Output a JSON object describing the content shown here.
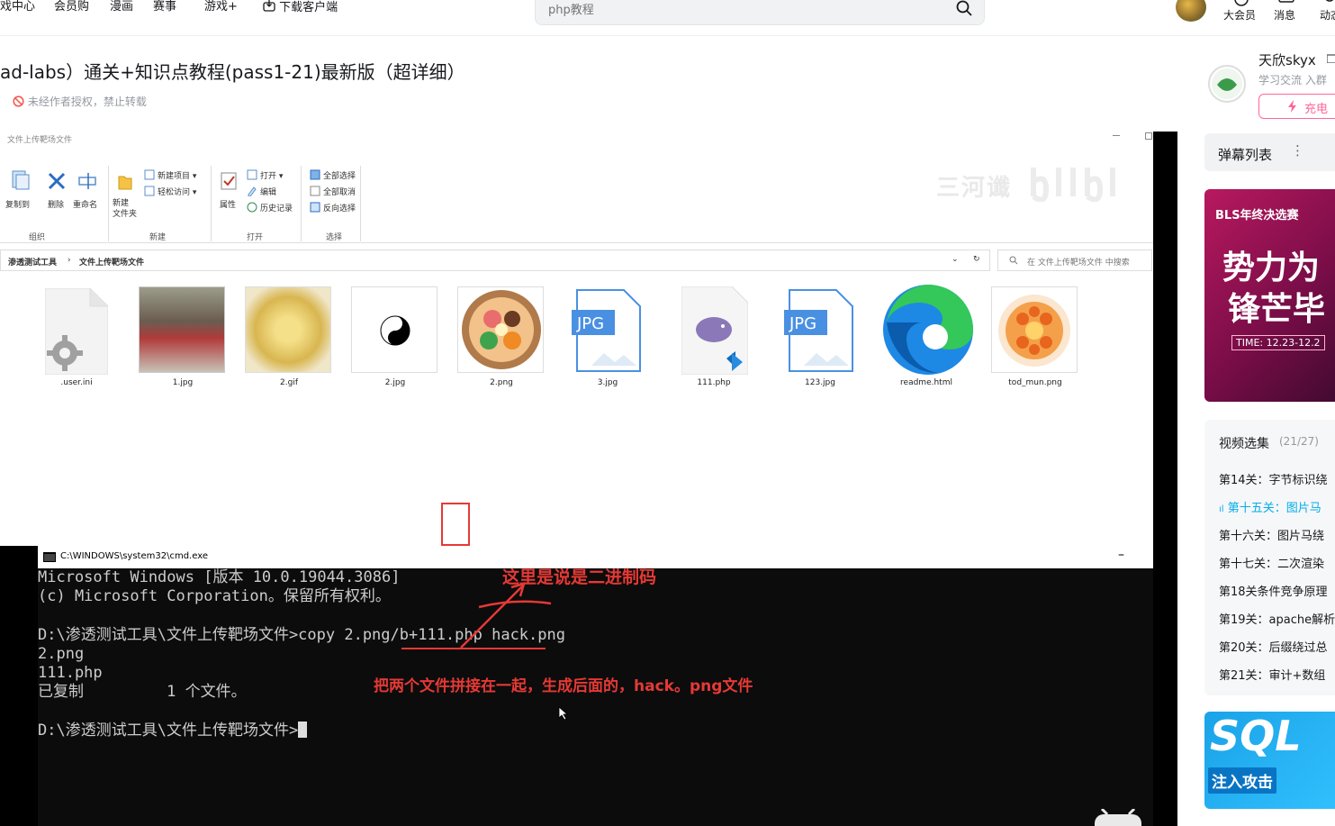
{
  "nav": {
    "items": [
      "戏中心",
      "会员购",
      "漫画",
      "赛事",
      "游戏+",
      "下载客户端"
    ],
    "search_placeholder": "php教程",
    "right": [
      "大会员",
      "消息",
      "动态"
    ]
  },
  "video": {
    "title": "ad-labs）通关+知识点教程(pass1-21)最新版（超详细）",
    "copyright": "未经作者授权，禁止转载"
  },
  "explorer": {
    "window_title": "文件上传靶场文件",
    "ribbon": {
      "organize": {
        "copy_to": "复制到",
        "delete": "删除",
        "rename": "重命名",
        "group": "组织"
      },
      "new": {
        "new_item": "新建项目 ▾",
        "easy_access": "轻松访问 ▾",
        "new_folder": "新建\n文件夹",
        "group": "新建"
      },
      "open": {
        "properties": "属性",
        "open": "打开 ▾",
        "edit": "编辑",
        "history": "历史记录",
        "group": "打开"
      },
      "select": {
        "select_all": "全部选择",
        "select_none": "全部取消",
        "invert": "反向选择",
        "group": "选择"
      }
    },
    "breadcrumb": [
      "渗透测试工具",
      "文件上传靶场文件"
    ],
    "search_placeholder": "在 文件上传靶场文件 中搜索",
    "files": [
      ".user.ini",
      "1.jpg",
      "2.gif",
      "2.jpg",
      "2.png",
      "3.jpg",
      "111.php",
      "123.jpg",
      "readme.html",
      "tod_mun.png"
    ],
    "watermark": "三河谶"
  },
  "cmd": {
    "title": "C:\\WINDOWS\\system32\\cmd.exe",
    "lines": [
      "Microsoft Windows [版本 10.0.19044.3086]",
      "(c) Microsoft Corporation。保留所有权利。",
      "",
      "D:\\渗透测试工具\\文件上传靶场文件>copy 2.png/b+111.php hack.png",
      "2.png",
      "111.php",
      "已复制         1 个文件。",
      "",
      "D:\\渗透测试工具\\文件上传靶场文件>"
    ],
    "annotation1": "这里是说是二进制码",
    "annotation2": "把两个文件拼接在一起，生成后面的，hack。png文件"
  },
  "uploader": {
    "name": "天欣skyx",
    "desc": "学习交流 入群",
    "charge": "充电"
  },
  "danmaku": {
    "title": "弹幕列表"
  },
  "ad": {
    "brand": "BLS年终决选赛",
    "line1": "势力为",
    "line2": "锋芒毕",
    "time": "TIME: 12.23-12.2"
  },
  "episodes": {
    "title": "视频选集",
    "count": "(21/27)",
    "items": [
      "第14关：字节标识绕",
      "第十五关：图片马",
      "第十六关：图片马绕",
      "第十七关：二次渲染",
      "第18关条件竞争原理",
      "第19关：apache解析",
      "第20关：后缀绕过总",
      "第21关：审计+数组"
    ],
    "active_index": 1
  },
  "sql_ad": {
    "big": "SQL",
    "small": "注入攻击"
  },
  "colors": {
    "accent": "#00aeec",
    "pink": "#ff6699",
    "annot": "#e53935"
  }
}
